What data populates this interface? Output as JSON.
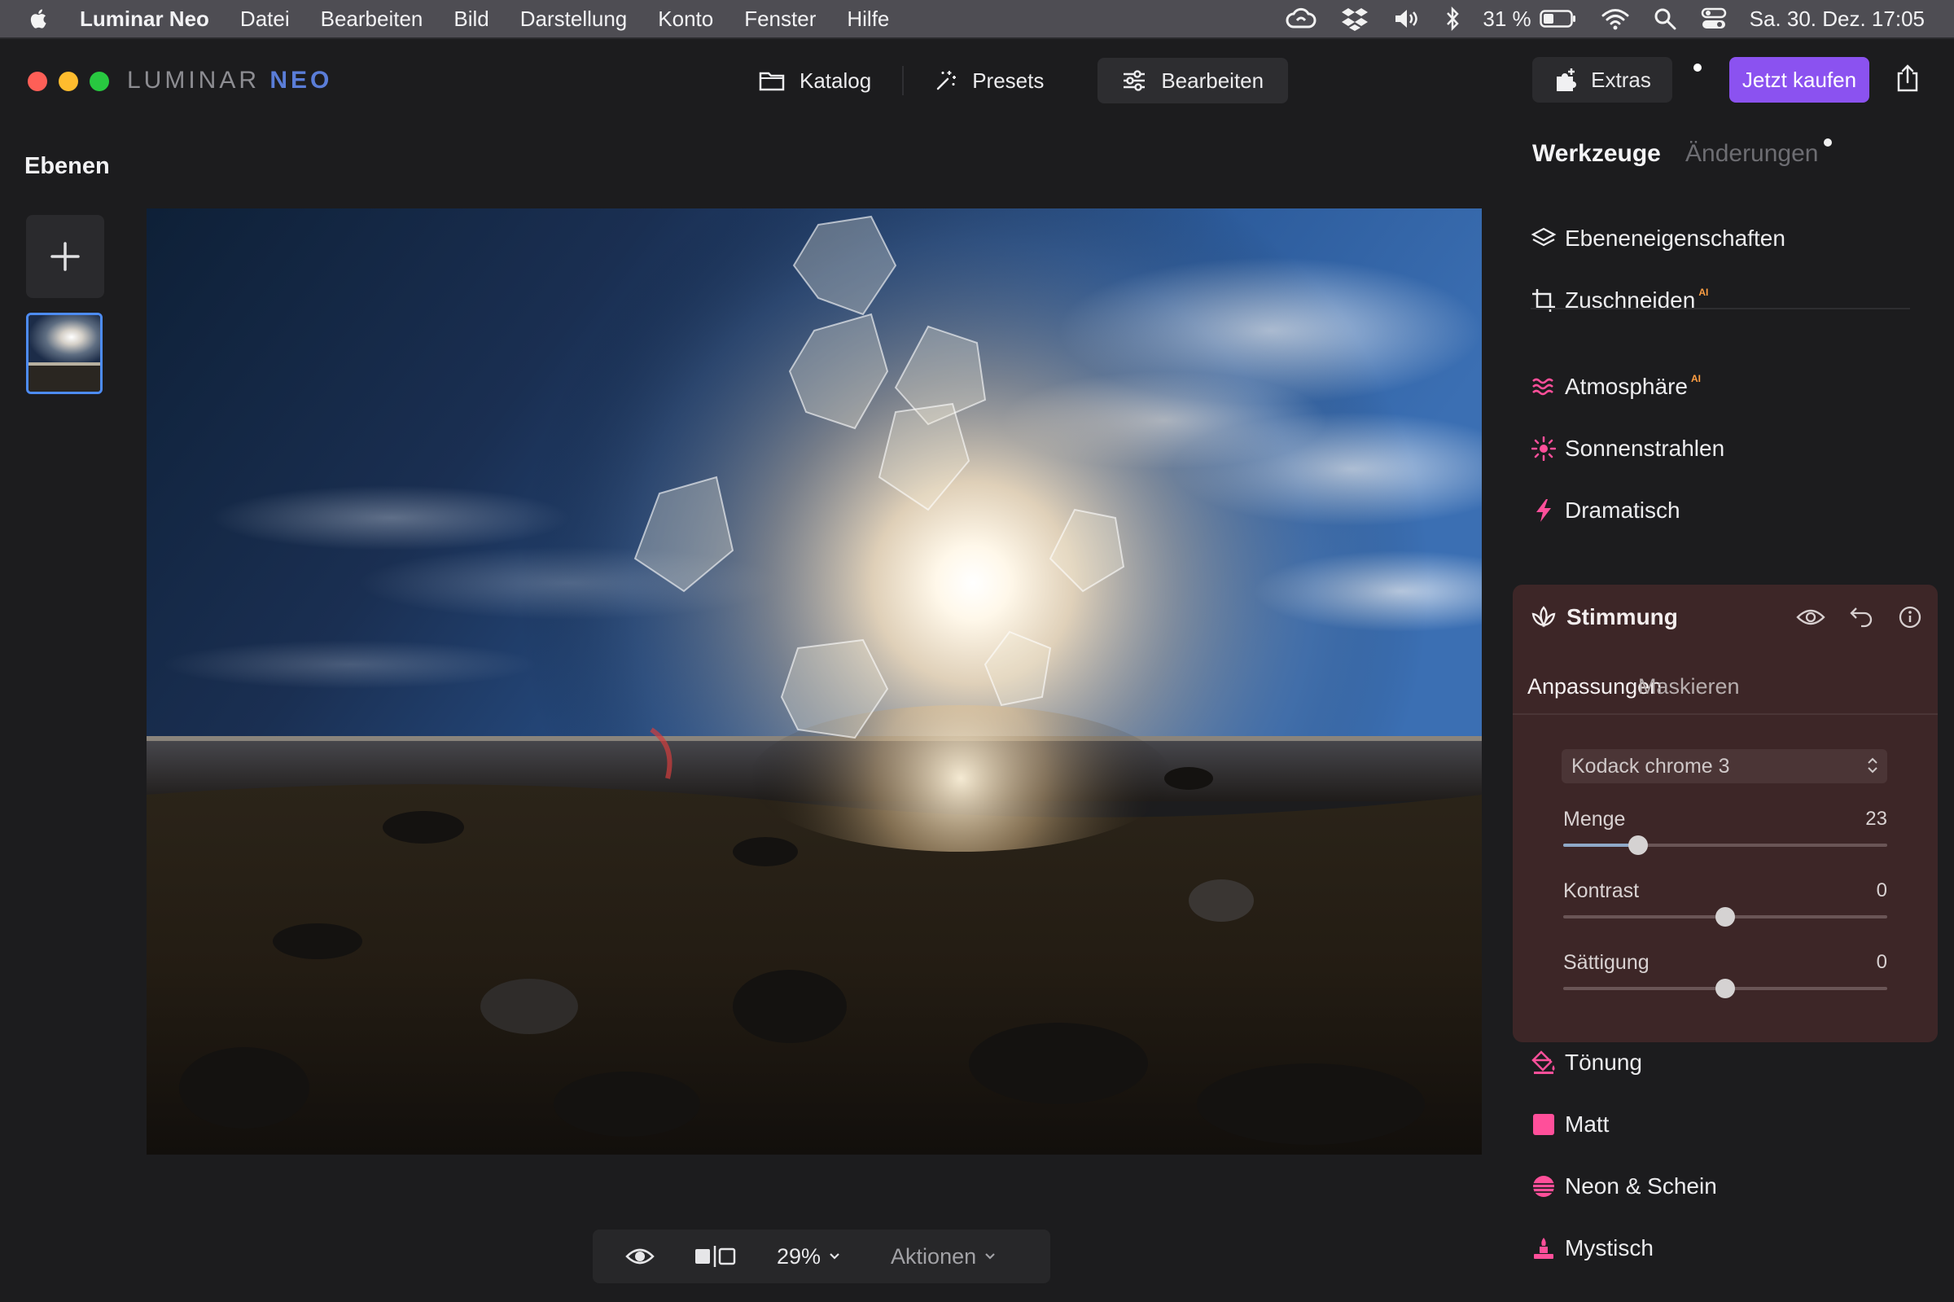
{
  "menubar": {
    "app_name": "Luminar Neo",
    "menus": [
      "Datei",
      "Bearbeiten",
      "Bild",
      "Darstellung",
      "Konto",
      "Fenster",
      "Hilfe"
    ],
    "battery": "31 %",
    "datetime": "Sa. 30. Dez.  17:05"
  },
  "window": {
    "brand_main": "LUMINAR",
    "brand_accent": "NEO",
    "nav": {
      "katalog": "Katalog",
      "presets": "Presets",
      "bearbeiten": "Bearbeiten",
      "active": "Bearbeiten"
    },
    "extras_label": "Extras",
    "buy_label": "Jetzt kaufen"
  },
  "layers": {
    "title": "Ebenen",
    "count": 1
  },
  "bottombar": {
    "zoom": "29%",
    "actions": "Aktionen"
  },
  "tools_panel": {
    "tab_tools": "Werkzeuge",
    "tab_changes": "Änderungen",
    "ai_badge": "AI",
    "tools_top": [
      {
        "label": "Ebeneneigenschaften",
        "icon": "layers-icon",
        "ai": false
      },
      {
        "label": "Zuschneiden",
        "icon": "crop-icon",
        "ai": true
      }
    ],
    "tools_mid": [
      {
        "label": "Atmosphäre",
        "icon": "atmosphere-icon",
        "ai": true
      },
      {
        "label": "Sonnenstrahlen",
        "icon": "sunrays-icon",
        "ai": false
      },
      {
        "label": "Dramatisch",
        "icon": "lightning-icon",
        "ai": false
      }
    ],
    "active_tool": {
      "label": "Stimmung",
      "subtab_adjust": "Anpassungen",
      "subtab_mask": "Maskieren",
      "lut": "Kodack chrome  3",
      "sliders": [
        {
          "label": "Menge",
          "value": "23",
          "min": 0,
          "max": 100,
          "pos": 23
        },
        {
          "label": "Kontrast",
          "value": "0",
          "min": -100,
          "max": 100,
          "pos": 0
        },
        {
          "label": "Sättigung",
          "value": "0",
          "min": -100,
          "max": 100,
          "pos": 0
        }
      ]
    },
    "tools_bottom": [
      {
        "label": "Tönung",
        "icon": "paint-bucket-icon"
      },
      {
        "label": "Matt",
        "icon": "matte-square-icon"
      },
      {
        "label": "Neon & Schein",
        "icon": "neon-icon"
      },
      {
        "label": "Mystisch",
        "icon": "mystic-icon"
      }
    ]
  },
  "colors": {
    "accent_purple": "#8b52f0",
    "tool_icon_pink": "#ff4f9a",
    "panel_active_bg": "#3d2627",
    "selection_blue": "#4d8cf5"
  }
}
